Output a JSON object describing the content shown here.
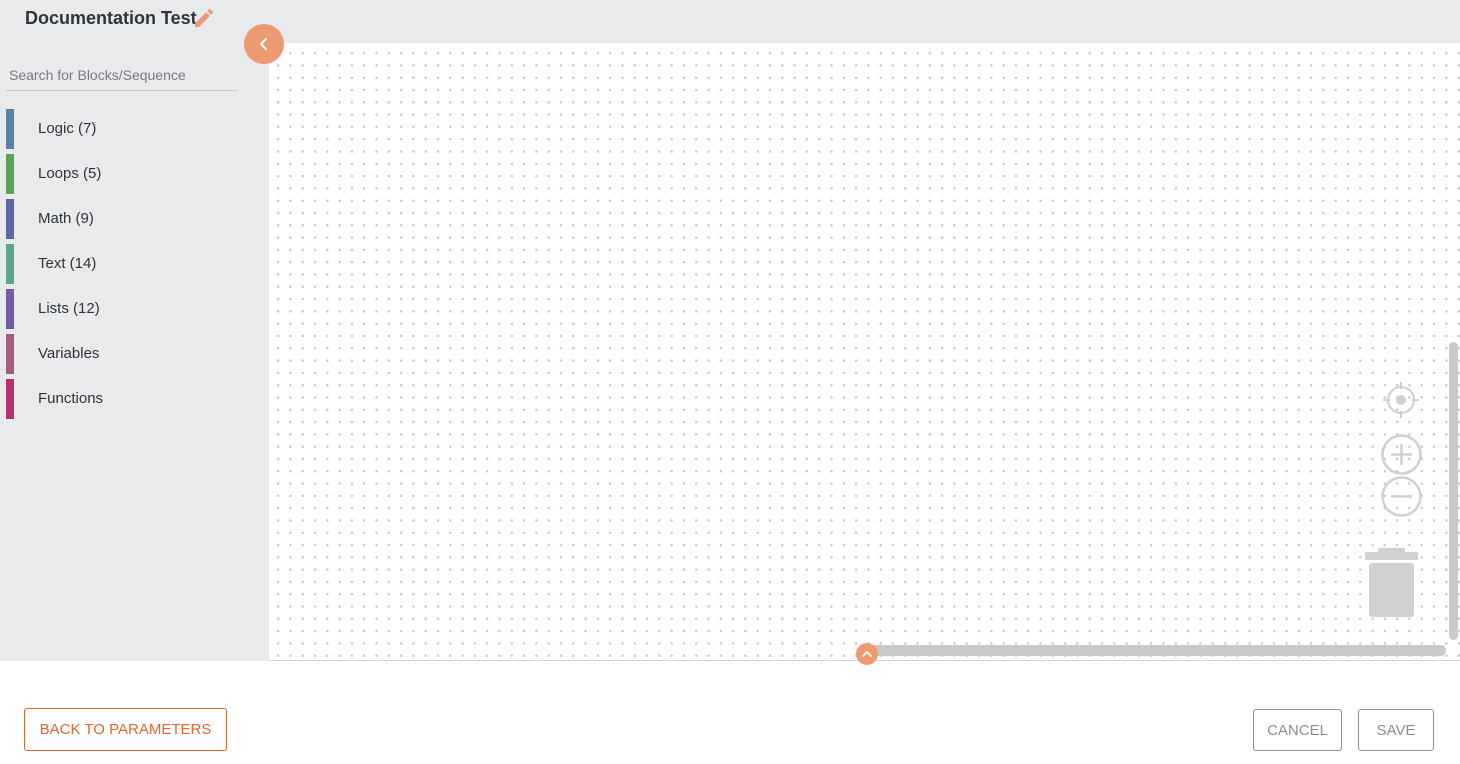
{
  "header": {
    "title": "Documentation Test",
    "edit_icon": "pencil-icon",
    "accent_color": "#ec9a72"
  },
  "sidebar": {
    "search_placeholder": "Search for Blocks/Sequence",
    "collapse_icon": "chevron-left-icon",
    "categories": [
      {
        "label": "Logic (7)",
        "color": "#5b80a5"
      },
      {
        "label": "Loops (5)",
        "color": "#5ba55b"
      },
      {
        "label": "Math (9)",
        "color": "#5b67a5"
      },
      {
        "label": "Text (14)",
        "color": "#5ba58c"
      },
      {
        "label": "Lists (12)",
        "color": "#745ba5"
      },
      {
        "label": "Variables",
        "color": "#a55b80"
      },
      {
        "label": "Functions",
        "color": "#b3316e"
      }
    ]
  },
  "workspace": {
    "controls": [
      "recenter-icon",
      "zoom-in-icon",
      "zoom-out-icon",
      "trash-icon"
    ]
  },
  "footer": {
    "back_label": "BACK TO PARAMETERS",
    "cancel_label": "CANCEL",
    "save_label": "SAVE",
    "primary_color": "#e0662c",
    "secondary_color": "#8b8e92"
  }
}
